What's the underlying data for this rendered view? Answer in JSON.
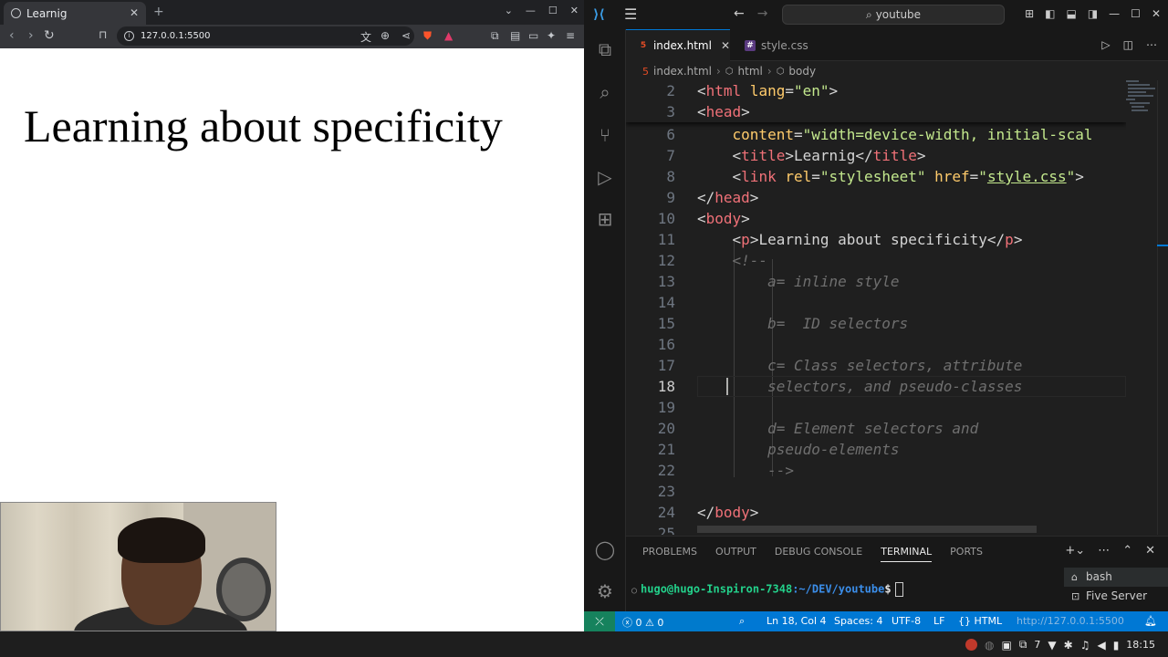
{
  "browser": {
    "tab_title": "Learnig",
    "url": "127.0.0.1:5500",
    "page_heading": "Learning about specificity",
    "new_tab": "+",
    "close": "✕"
  },
  "vscode": {
    "search": "youtube",
    "tabs": [
      {
        "label": "index.html",
        "icon": "html5-icon",
        "active": true
      },
      {
        "label": "style.css",
        "icon": "css-icon",
        "active": false
      }
    ],
    "breadcrumb": [
      "index.html",
      "html",
      "body"
    ],
    "panel": {
      "tabs": [
        "PROBLEMS",
        "OUTPUT",
        "DEBUG CONSOLE",
        "TERMINAL",
        "PORTS"
      ],
      "active_tab": "TERMINAL",
      "prompt_user": "hugo@hugo-Inspiron-7348",
      "prompt_path": ":~/DEV/youtube",
      "prompt_symbol": "$",
      "terminals": [
        "bash",
        "Five Server"
      ]
    },
    "status": {
      "errors": "0",
      "warnings": "0",
      "position": "Ln 18, Col 4",
      "spaces": "Spaces: 4",
      "encoding": "UTF-8",
      "eol": "LF",
      "language": "HTML",
      "server": "http://127.0.0.1:5500"
    }
  },
  "taskbar": {
    "time": "18:15",
    "wifi_count": "7"
  }
}
